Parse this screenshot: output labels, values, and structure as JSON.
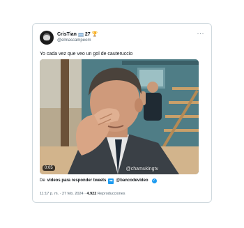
{
  "tweet": {
    "author": {
      "display_name": "CrisTian",
      "name_suffix": "27",
      "handle": "@elmascampeom",
      "badges": [
        "argentina-flag-icon",
        "trophy-icon"
      ]
    },
    "more_label": "···",
    "text": "Yo cada vez que veo un gol de cauteruccio",
    "video": {
      "duration": "0:05",
      "watermark": "@chamukingtv"
    },
    "source": {
      "prefix": "De",
      "link_text": "videos para responder tweets",
      "account": "@bancodevideo"
    },
    "meta": {
      "time": "11:17 p. m.",
      "separator": " · ",
      "date": "27 feb. 2024",
      "views_count": "4.922",
      "views_label": "Reproducciones"
    }
  },
  "colors": {
    "text": "#0f1419",
    "secondary": "#536471",
    "accent": "#1d9bf0",
    "border": "#cfd9de"
  }
}
